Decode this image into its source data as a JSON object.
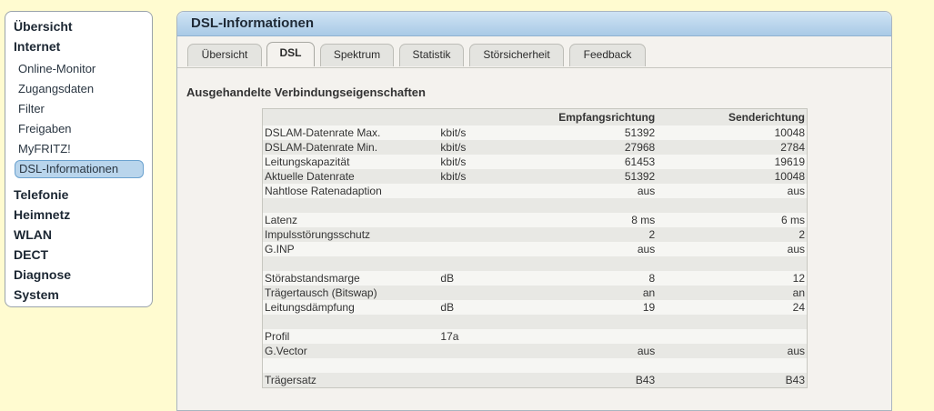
{
  "nav": {
    "overview": "Übersicht",
    "internet": "Internet",
    "internet_items": [
      "Online-Monitor",
      "Zugangsdaten",
      "Filter",
      "Freigaben",
      "MyFRITZ!",
      "DSL-Informationen"
    ],
    "telefonie": "Telefonie",
    "heimnetz": "Heimnetz",
    "wlan": "WLAN",
    "dect": "DECT",
    "diagnose": "Diagnose",
    "system": "System"
  },
  "panel": {
    "title": "DSL-Informationen",
    "tabs": [
      "Übersicht",
      "DSL",
      "Spektrum",
      "Statistik",
      "Störsicherheit",
      "Feedback"
    ],
    "active_tab": "DSL",
    "section_title": "Ausgehandelte Verbindungseigenschaften"
  },
  "table": {
    "headers": [
      "",
      "",
      "Empfangsrichtung",
      "Senderichtung"
    ],
    "rows": [
      [
        "DSLAM-Datenrate Max.",
        "kbit/s",
        "51392",
        "10048"
      ],
      [
        "DSLAM-Datenrate Min.",
        "kbit/s",
        "27968",
        "2784"
      ],
      [
        "Leitungskapazität",
        "kbit/s",
        "61453",
        "19619"
      ],
      [
        "Aktuelle Datenrate",
        "kbit/s",
        "51392",
        "10048"
      ],
      [
        "Nahtlose Ratenadaption",
        "",
        "aus",
        "aus"
      ],
      [
        "",
        "",
        "",
        ""
      ],
      [
        "Latenz",
        "",
        "8 ms",
        "6 ms"
      ],
      [
        "Impulsstörungsschutz",
        "",
        "2",
        "2"
      ],
      [
        "G.INP",
        "",
        "aus",
        "aus"
      ],
      [
        "",
        "",
        "",
        ""
      ],
      [
        "Störabstandsmarge",
        "dB",
        "8",
        "12"
      ],
      [
        "Trägertausch (Bitswap)",
        "",
        "an",
        "an"
      ],
      [
        "Leitungsdämpfung",
        "dB",
        "19",
        "24"
      ],
      [
        "",
        "",
        "",
        ""
      ],
      [
        "Profil",
        "17a",
        "",
        ""
      ],
      [
        "G.Vector",
        "",
        "aus",
        "aus"
      ],
      [
        "",
        "",
        "",
        ""
      ],
      [
        "Trägersatz",
        "",
        "B43",
        "B43"
      ]
    ]
  }
}
